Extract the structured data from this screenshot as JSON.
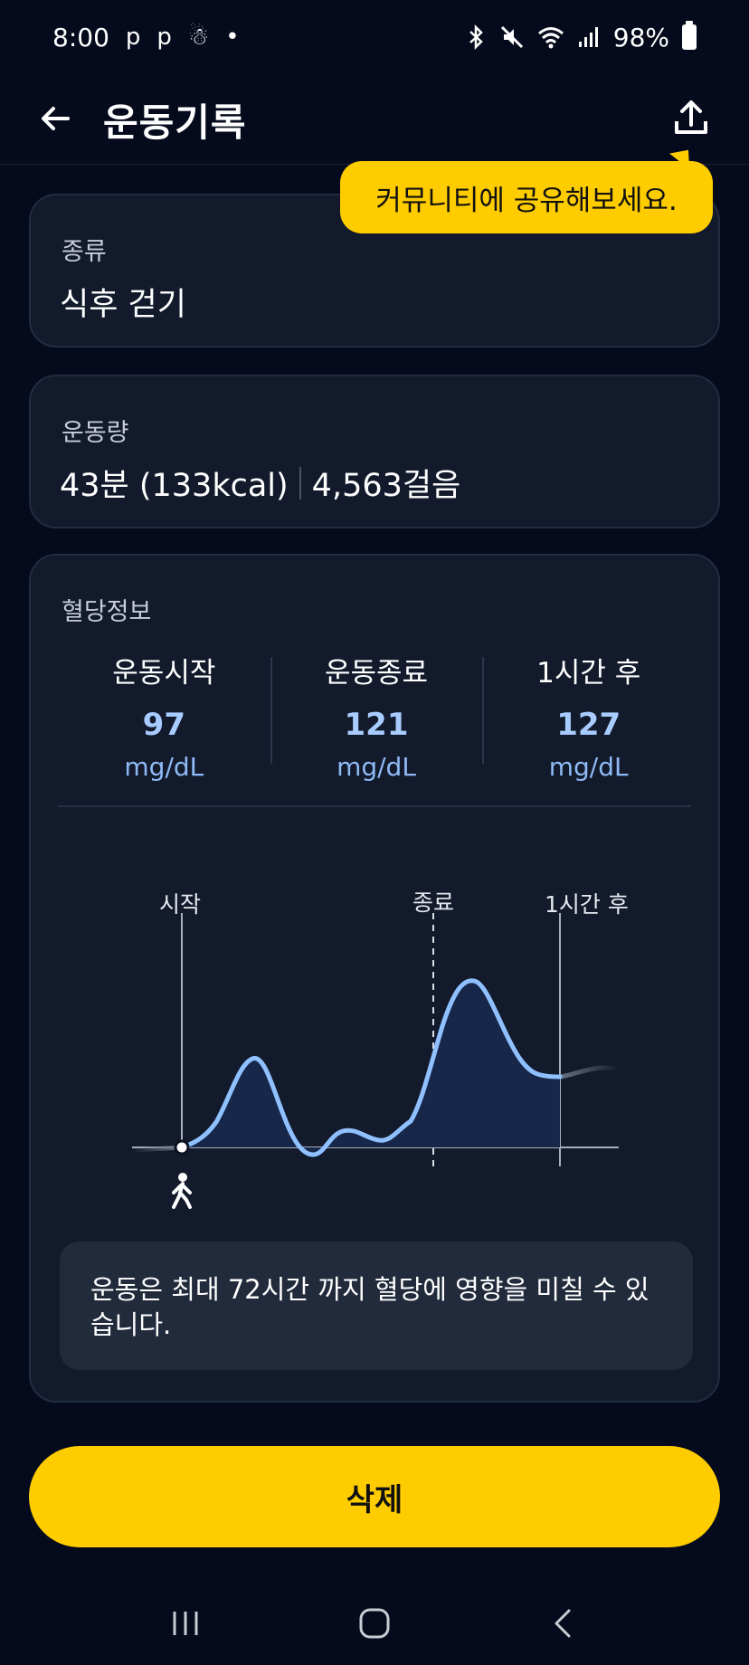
{
  "status_bar": {
    "time": "8:00",
    "left_icons": [
      "p",
      "p"
    ],
    "battery": "98%"
  },
  "header": {
    "title": "운동기록",
    "back_icon": "arrow-left-icon",
    "share_icon": "share-upload-icon"
  },
  "tooltip": {
    "text": "커뮤니티에 공유해보세요."
  },
  "type_card": {
    "label": "종류",
    "value": "식후 걷기"
  },
  "amount_card": {
    "label": "운동량",
    "duration": "43분 (133kcal)",
    "steps": "4,563걸음"
  },
  "glucose_card": {
    "label": "혈당정보",
    "stats": [
      {
        "label": "운동시작",
        "value": "97",
        "unit": "mg/dL"
      },
      {
        "label": "운동종료",
        "value": "121",
        "unit": "mg/dL"
      },
      {
        "label": "1시간 후",
        "value": "127",
        "unit": "mg/dL"
      }
    ],
    "chart_markers": {
      "start": "시작",
      "end": "종료",
      "after": "1시간 후"
    },
    "notice": "운동은 최대 72시간 까지 혈당에 영향을 미칠 수 있습니다."
  },
  "delete_button": {
    "label": "삭제"
  },
  "colors": {
    "accent": "#ffcc00",
    "background": "#050b1c",
    "card": "#121a2b",
    "value_blue": "#a8ccff",
    "curve": "#8fc0ff"
  }
}
